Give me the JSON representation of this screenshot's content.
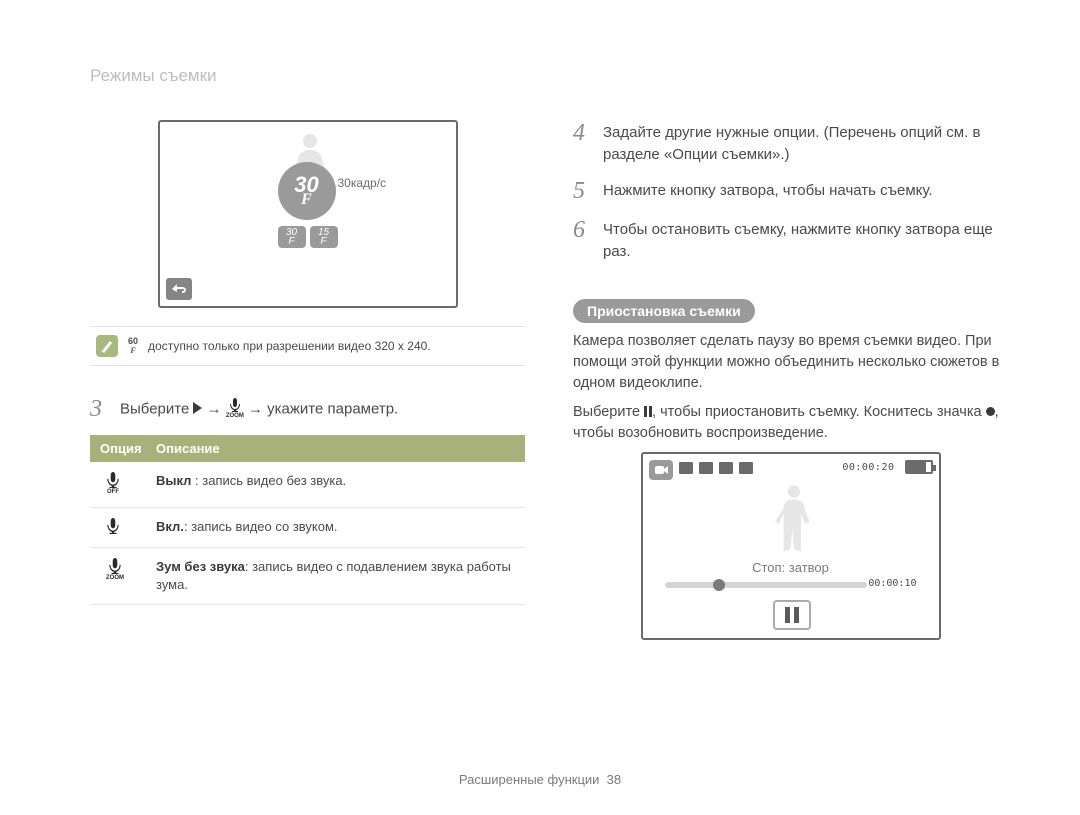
{
  "section_title": "Режимы съемки",
  "left": {
    "screen1_label": "30кадр/с",
    "badge_big": {
      "num": "30",
      "f": "F"
    },
    "sub_badge_1": {
      "t": "30",
      "b": "F"
    },
    "sub_badge_2": {
      "t": "15",
      "b": "F"
    },
    "note_icon_top": "60",
    "note_icon_bot": "F",
    "note_text": "доступно только при разрешении видео 320 x 240.",
    "step3": {
      "number": "3",
      "pre": "Выберите ",
      "mid": " → ",
      "post": " → укажите параметр."
    },
    "table": {
      "h1": "Опция",
      "h2": "Описание",
      "rows": [
        {
          "icon": "mic-off",
          "b": "Выкл",
          "t": " : запись видео без звука."
        },
        {
          "icon": "mic-on",
          "b": "Вкл.",
          "t": ": запись видео со звуком."
        },
        {
          "icon": "mic-zoom",
          "b": "Зум без звука",
          "t": ": запись видео с подавлением звука работы зума."
        }
      ]
    }
  },
  "right": {
    "step4": {
      "n": "4",
      "t": "Задайте другие нужные опции. (Перечень опций см. в разделе «Опции съемки».)"
    },
    "step5": {
      "n": "5",
      "t": "Нажмите кнопку затвора, чтобы начать съемку."
    },
    "step6": {
      "n": "6",
      "t": "Чтобы остановить съемку, нажмите кнопку затвора еще раз."
    },
    "sub_heading": "Приостановка съемки",
    "para1": "Камера позволяет сделать паузу во время съемки видео. При помощи этой функции можно объединить несколько сюжетов в одном видеоклипе.",
    "para2_pre": "Выберите ",
    "para2_mid": ", чтобы приостановить съемку. Коснитесь значка ",
    "para2_post": ", чтобы возобновить воспроизведение.",
    "screen2": {
      "time_tr": "00:00:20",
      "stop": "Стоп: затвор",
      "time_bar": "00:00:10"
    }
  },
  "footer": {
    "label": "Расширенные функции",
    "page": "38"
  }
}
